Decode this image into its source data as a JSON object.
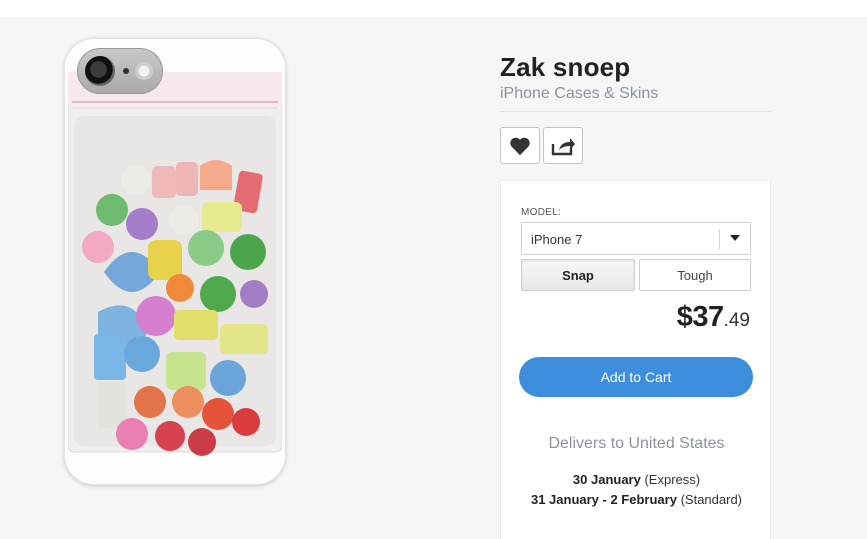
{
  "product": {
    "title": "Zak snoep",
    "category": "iPhone Cases & Skins"
  },
  "actions": {
    "favorite_icon": "heart-icon",
    "share_icon": "share-icon"
  },
  "configurator": {
    "model_label": "MODEL:",
    "model_selected": "iPhone 7",
    "case_types": [
      "Snap",
      "Tough"
    ],
    "selected_case_type": "Snap"
  },
  "price": {
    "main": "$37",
    "cents": ".49"
  },
  "cart": {
    "add_label": "Add to Cart",
    "accent_color": "#3d8fde"
  },
  "delivery": {
    "heading": "Delivers to United States",
    "options": [
      {
        "dates": "30 January",
        "method": "(Express)"
      },
      {
        "dates": "31 January - 2 February",
        "method": "(Standard)"
      }
    ]
  }
}
